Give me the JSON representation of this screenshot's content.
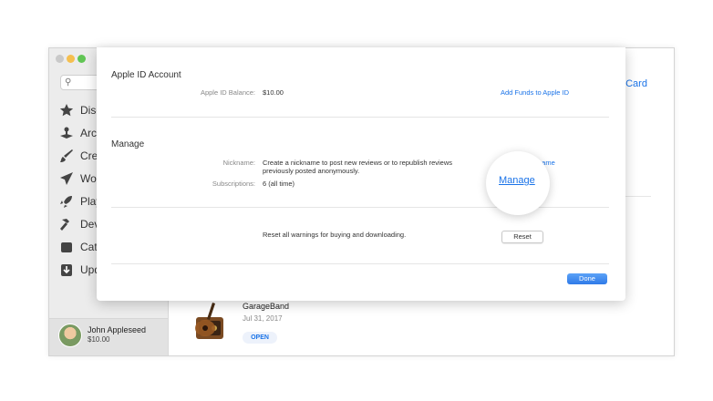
{
  "sidebar": {
    "items": [
      {
        "label": "Disc",
        "icon": "star-icon"
      },
      {
        "label": "Arca",
        "icon": "arcade-icon"
      },
      {
        "label": "Crea",
        "icon": "brush-icon"
      },
      {
        "label": "Wor",
        "icon": "paperplane-icon"
      },
      {
        "label": "Play",
        "icon": "rocket-icon"
      },
      {
        "label": "Dev",
        "icon": "hammer-icon"
      },
      {
        "label": "Cate",
        "icon": "categories-icon"
      },
      {
        "label": "Upd",
        "icon": "updates-icon"
      }
    ]
  },
  "user": {
    "name": "John Appleseed",
    "balance": "$10.00"
  },
  "main": {
    "peek_link": "t Card",
    "app": {
      "name": "GarageBand",
      "date": "Jul 31, 2017",
      "action": "OPEN"
    }
  },
  "sheet": {
    "apple_id_title": "Apple ID Account",
    "balance_label": "Apple ID Balance:",
    "balance_value": "$10.00",
    "add_funds": "Add Funds to Apple ID",
    "manage_title": "Manage",
    "nickname_label": "Nickname:",
    "nickname_text_1": "Create a nickname to post new reviews or to republish reviews",
    "nickname_text_2": "previously posted anonymously.",
    "nickname_link_partial": "name",
    "subscriptions_label": "Subscriptions:",
    "subscriptions_value": "6 (all time)",
    "manage_link": "Manage",
    "reset_text": "Reset all warnings for buying and downloading.",
    "reset_button": "Reset",
    "done_button": "Done"
  }
}
